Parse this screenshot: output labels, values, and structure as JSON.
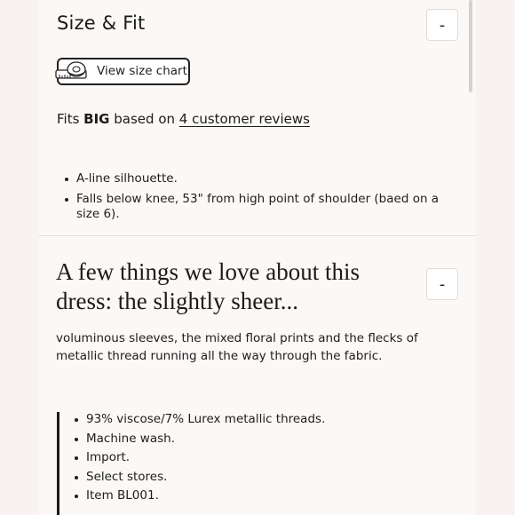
{
  "size_fit": {
    "title": "Size & Fit",
    "toggle_symbol": "-",
    "size_chart_label": "View size chart",
    "size_chart_icon": "measuring-tape-icon",
    "fit_prefix": "Fits ",
    "fit_value": "BIG",
    "fit_middle": " based on ",
    "fit_reviews_link": "4 customer reviews",
    "bullets": [
      "A-line silhouette.",
      "Falls below knee, 53\" from high point of shoulder (baed on a size 6)."
    ]
  },
  "details": {
    "heading": "A few things we love about this dress: the slightly sheer...",
    "toggle_symbol": "-",
    "description": "voluminous sleeves, the mixed floral prints and the flecks of metallic thread running all the way through the fabric.",
    "bullets": [
      "93% viscose/7% Lurex metallic threads.",
      "Machine wash.",
      "Import.",
      "Select stores.",
      "Item BL001."
    ]
  }
}
